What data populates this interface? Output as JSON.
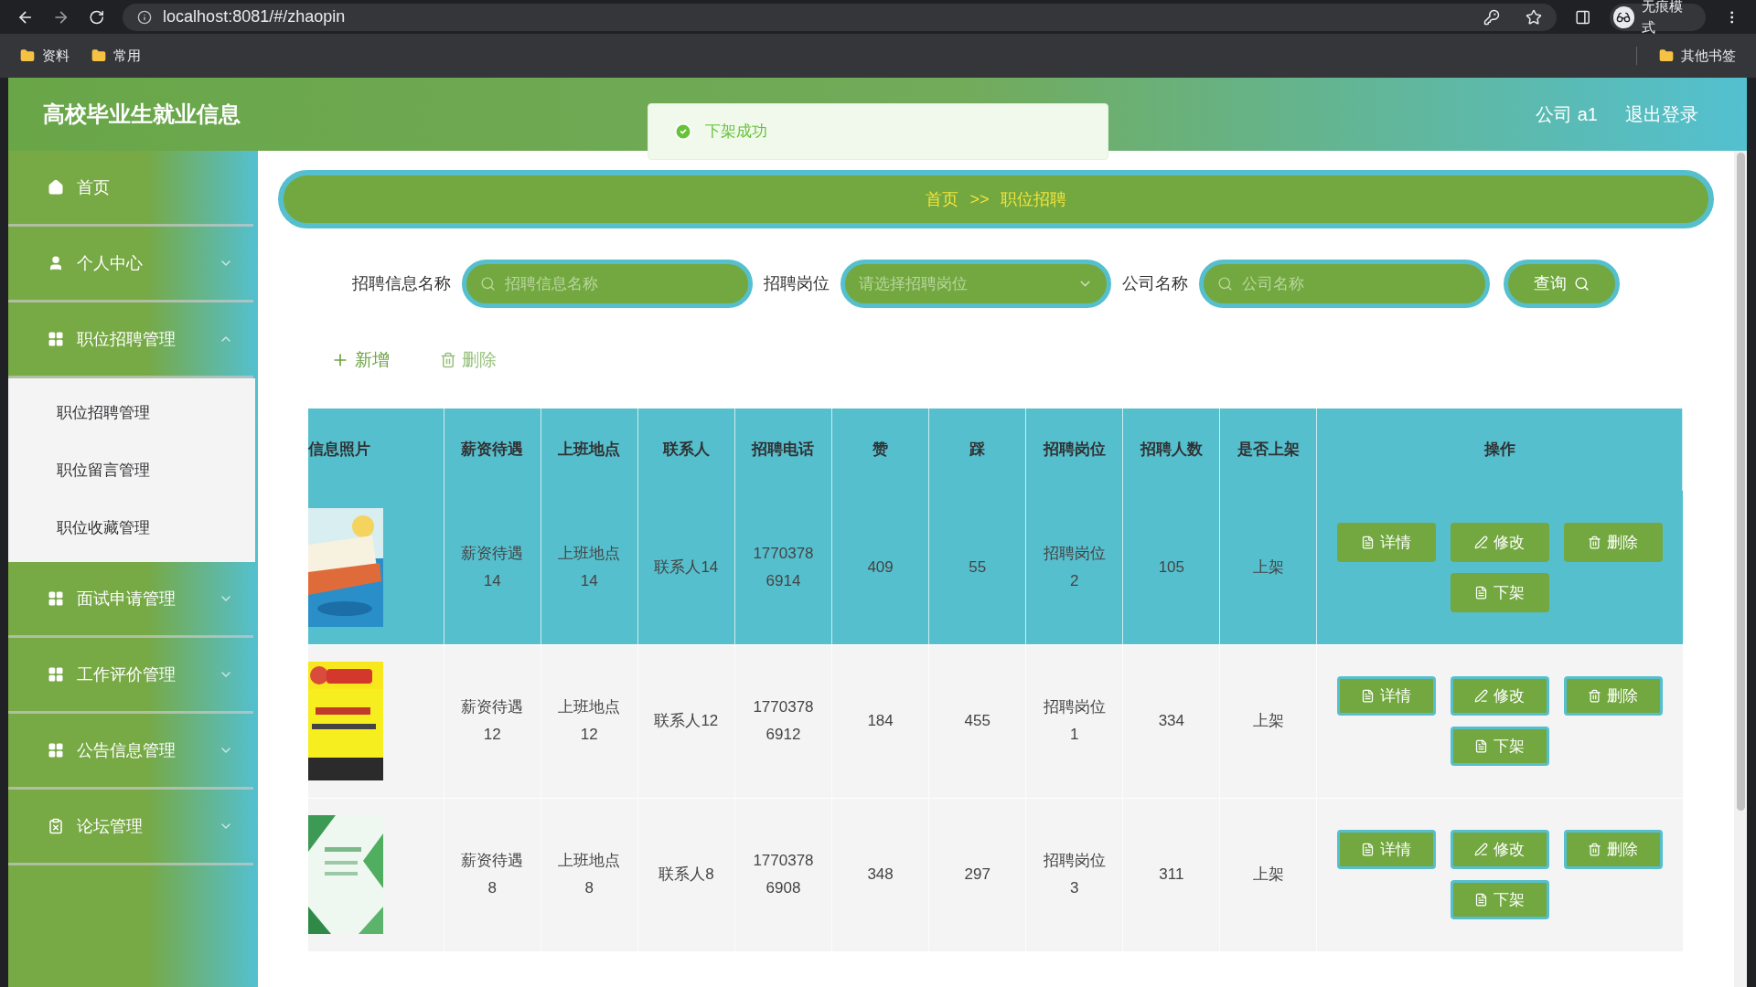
{
  "browser": {
    "url": "localhost:8081/#/zhaopin",
    "profile_label": "无痕模式",
    "bookmarks": [
      "资料",
      "常用"
    ],
    "other_bookmarks": "其他书签"
  },
  "header": {
    "title": "高校毕业生就业信息",
    "user": "公司 a1",
    "logout": "退出登录"
  },
  "toast": {
    "message": "下架成功"
  },
  "sidebar": {
    "items": [
      {
        "label": "首页",
        "kind": "home"
      },
      {
        "label": "个人中心",
        "kind": "user",
        "expanded": false
      },
      {
        "label": "职位招聘管理",
        "kind": "grid",
        "expanded": true,
        "children": [
          {
            "label": "职位招聘管理"
          },
          {
            "label": "职位留言管理"
          },
          {
            "label": "职位收藏管理"
          }
        ]
      },
      {
        "label": "面试申请管理",
        "kind": "grid",
        "expanded": false
      },
      {
        "label": "工作评价管理",
        "kind": "grid",
        "expanded": false
      },
      {
        "label": "公告信息管理",
        "kind": "grid",
        "expanded": false
      },
      {
        "label": "论坛管理",
        "kind": "clipboard",
        "expanded": false
      }
    ]
  },
  "breadcrumb": {
    "items": [
      "首页",
      "职位招聘"
    ],
    "separator": ">>"
  },
  "search": {
    "fields": [
      {
        "label": "招聘信息名称",
        "placeholder": "招聘信息名称",
        "kind": "input"
      },
      {
        "label": "招聘岗位",
        "placeholder": "请选择招聘岗位",
        "kind": "select"
      },
      {
        "label": "公司名称",
        "placeholder": "公司名称",
        "kind": "input"
      }
    ],
    "button": "查询"
  },
  "actions": [
    {
      "label": "新增",
      "kind": "add"
    },
    {
      "label": "删除",
      "kind": "delete"
    }
  ],
  "table": {
    "columns": [
      "信息照片",
      "薪资待遇",
      "上班地点",
      "联系人",
      "招聘电话",
      "赞",
      "踩",
      "招聘岗位",
      "招聘人数",
      "是否上架",
      "操作"
    ],
    "rows": [
      {
        "hovered": true,
        "cells": [
          {
            "kind": "picture"
          },
          "薪资待遇14",
          "上班地点14",
          "联系人14",
          "17703786914",
          "409",
          "55",
          "招聘岗位2",
          "105",
          "上架"
        ],
        "buttons": [
          {
            "label": "详情",
            "kind": "detail"
          },
          {
            "label": "修改",
            "kind": "edit"
          },
          {
            "label": "删除",
            "kind": "delete"
          },
          {
            "label": "下架",
            "kind": "detail"
          }
        ]
      },
      {
        "hovered": false,
        "cells": [
          {
            "kind": "picture"
          },
          "薪资待遇12",
          "上班地点12",
          "联系人12",
          "17703786912",
          "184",
          "455",
          "招聘岗位1",
          "334",
          "上架"
        ],
        "buttons": [
          {
            "label": "详情",
            "kind": "detail"
          },
          {
            "label": "修改",
            "kind": "edit"
          },
          {
            "label": "删除",
            "kind": "delete"
          },
          {
            "label": "下架",
            "kind": "detail"
          }
        ]
      },
      {
        "hovered": false,
        "cells": [
          {
            "kind": "picture"
          },
          "薪资待遇8",
          "上班地点8",
          "联系人8",
          "17703786908",
          "348",
          "297",
          "招聘岗位3",
          "311",
          "上架"
        ],
        "buttons": [
          {
            "label": "详情",
            "kind": "detail"
          },
          {
            "label": "修改",
            "kind": "edit"
          },
          {
            "label": "删除",
            "kind": "delete"
          },
          {
            "label": "下架",
            "kind": "detail"
          }
        ]
      }
    ]
  }
}
